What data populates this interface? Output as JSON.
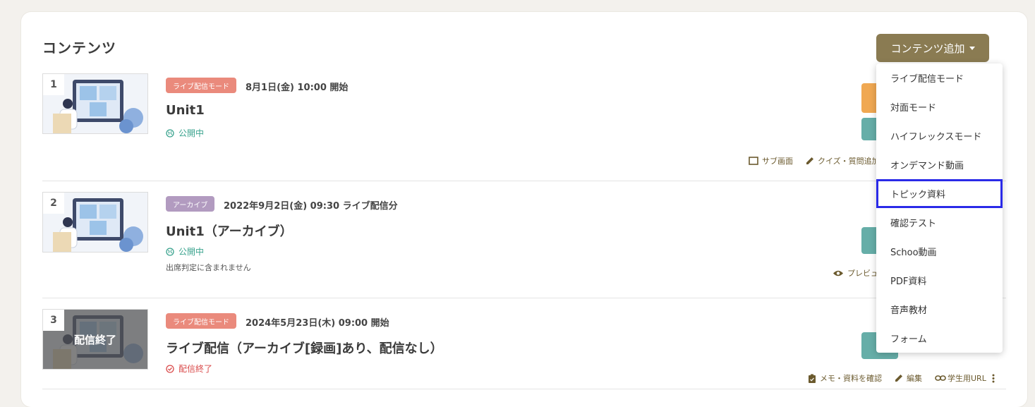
{
  "page_title": "コンテンツ",
  "add_button": {
    "label": "コンテンツ追加"
  },
  "dropdown": {
    "items": [
      {
        "label": "ライブ配信モード"
      },
      {
        "label": "対面モード"
      },
      {
        "label": "ハイフレックスモード"
      },
      {
        "label": "オンデマンド動画"
      },
      {
        "label": "トピック資料",
        "highlighted": true
      },
      {
        "label": "確認テスト"
      },
      {
        "label": "Schoo動画"
      },
      {
        "label": "PDF資料"
      },
      {
        "label": "音声教材"
      },
      {
        "label": "フォーム"
      }
    ]
  },
  "contents": [
    {
      "number": "1",
      "badge": "ライブ配信モード",
      "datetime": "8月1日(金) 10:00 開始",
      "title": "Unit1",
      "status": "公開中",
      "actions": [
        "サブ画面",
        "クイズ・質問追加"
      ]
    },
    {
      "number": "2",
      "badge": "アーカイブ",
      "datetime": "2022年9月2日(金) 09:30 ライブ配信分",
      "title": "Unit1（アーカイブ）",
      "status": "公開中",
      "note": "出席判定に含まれません",
      "actions": [
        "プレビュー"
      ]
    },
    {
      "number": "3",
      "thumb_overlay": "配信終了",
      "badge": "ライブ配信モード",
      "datetime": "2024年5月23日(木) 09:00 開始",
      "title": "ライブ配信（アーカイブ[録画]あり、配信なし）",
      "status": "配信終了",
      "actions": [
        "メモ・資料を確認",
        "編集",
        "学生用URL"
      ]
    }
  ],
  "colors": {
    "add_button": "#8a7b52",
    "live_badge": "#ea8a7c",
    "archive_badge": "#b29bc0",
    "published": "#3aa38e",
    "ended": "#d94a4a",
    "highlight_border": "#2a2ae8"
  }
}
